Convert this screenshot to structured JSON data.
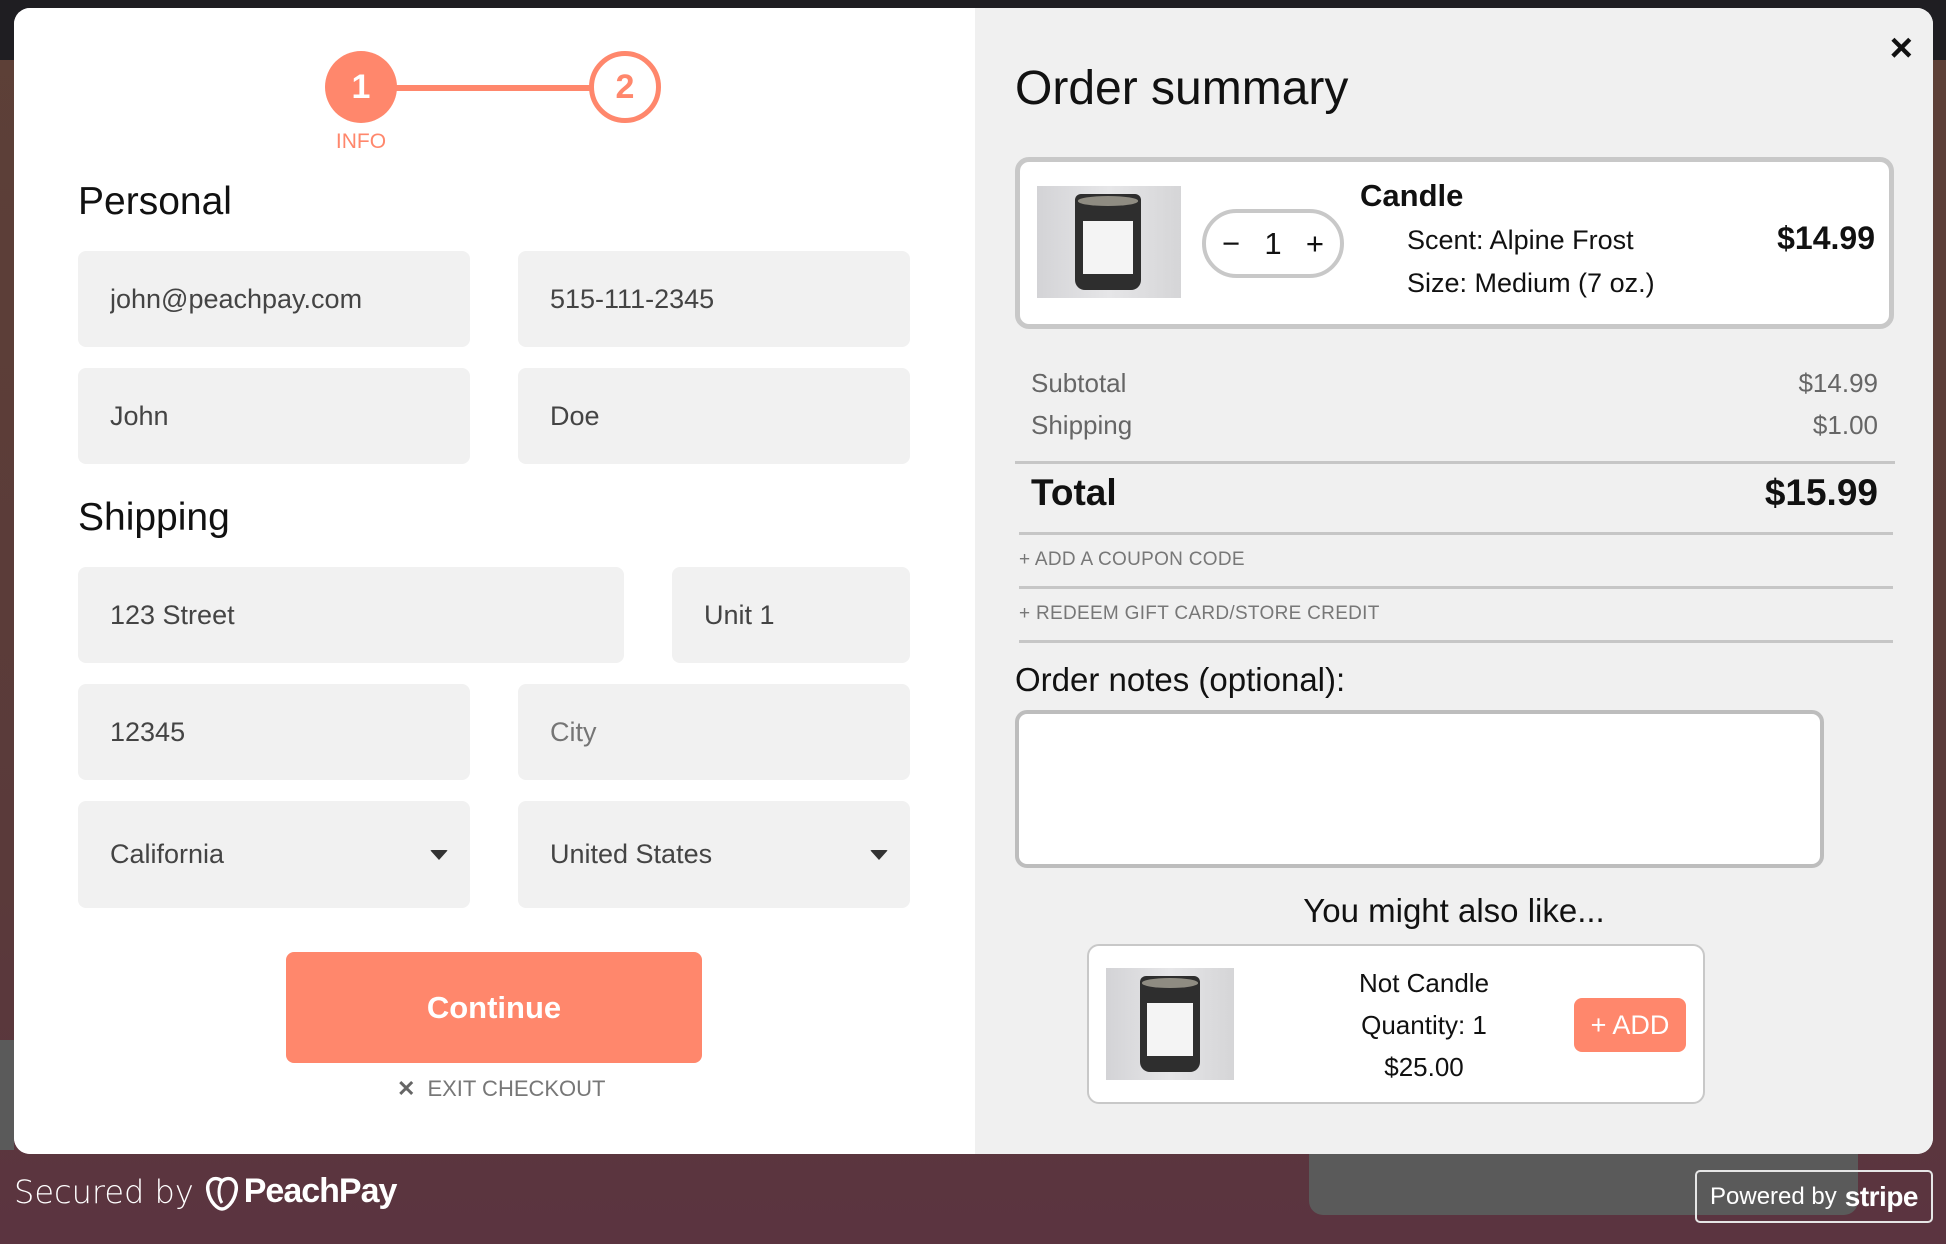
{
  "stepper": {
    "steps": [
      {
        "number": "1",
        "label": "INFO",
        "active": true
      },
      {
        "number": "2",
        "label": "",
        "active": false
      }
    ]
  },
  "personal": {
    "title": "Personal",
    "email": "john@peachpay.com",
    "phone": "515-111-2345",
    "first_name": "John",
    "last_name": "Doe"
  },
  "shipping": {
    "title": "Shipping",
    "address": "123 Street",
    "unit": "Unit 1",
    "postal": "12345",
    "city_placeholder": "City",
    "state": "California",
    "country": "United States"
  },
  "actions": {
    "continue_label": "Continue",
    "exit_label": "EXIT CHECKOUT"
  },
  "summary": {
    "title": "Order summary",
    "close_icon": "×",
    "item": {
      "name": "Candle",
      "quantity": "1",
      "scent": "Scent: Alpine Frost",
      "size": "Size: Medium (7 oz.)",
      "price": "$14.99"
    },
    "subtotal_label": "Subtotal",
    "subtotal_value": "$14.99",
    "shipping_label": "Shipping",
    "shipping_value": "$1.00",
    "total_label": "Total",
    "total_value": "$15.99",
    "coupon_link": "+ ADD A COUPON CODE",
    "gift_link": "+ REDEEM GIFT CARD/STORE CREDIT",
    "notes_label": "Order notes (optional):",
    "notes_value": "",
    "recommend_title": "You might also like...",
    "recommendation": {
      "name": "Not Candle",
      "quantity": "Quantity: 1",
      "price": "$25.00",
      "add_label": "+ ADD"
    }
  },
  "footer": {
    "secured_by": "Secured by",
    "brand": "PeachPay",
    "powered_by": "Powered by",
    "stripe": "stripe"
  },
  "colors": {
    "accent": "#ff876c",
    "panel": "#f0f0f0",
    "field": "#f1f1f1"
  }
}
